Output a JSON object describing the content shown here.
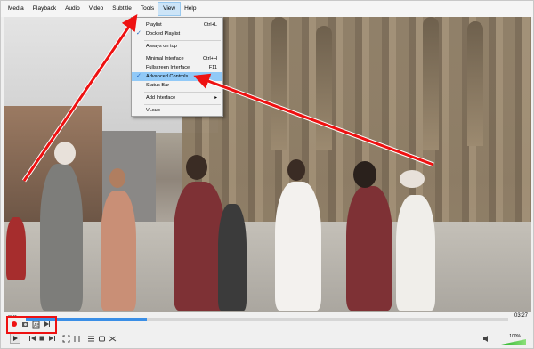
{
  "menubar": {
    "items": [
      "Media",
      "Playback",
      "Audio",
      "Video",
      "Subtitle",
      "Tools",
      "View",
      "Help"
    ]
  },
  "view_menu": {
    "items": [
      {
        "label": "Playlist",
        "shortcut": "Ctrl+L"
      },
      {
        "label": "Docked Playlist",
        "checked": true
      },
      {
        "label": "Always on top"
      },
      {
        "label": "Minimal Interface",
        "shortcut": "Ctrl+H"
      },
      {
        "label": "Fullscreen Interface",
        "shortcut": "F11"
      },
      {
        "label": "Advanced Controls",
        "checked": true,
        "highlighted": true
      },
      {
        "label": "Status Bar"
      },
      {
        "label": "Add Interface",
        "submenu": true
      },
      {
        "label": "VLsub"
      }
    ]
  },
  "playback": {
    "elapsed": "--:--",
    "total": "03:27",
    "progress": 0.25
  },
  "volume": {
    "label": "100%",
    "level": 1.0
  },
  "colors": {
    "highlight": "#91c9f7",
    "annotation": "#e11111",
    "seek_fill": "#3a8ee6"
  },
  "icons": {
    "advanced": [
      "record-icon",
      "snapshot-icon",
      "loop-ab-icon",
      "frame-step-icon"
    ],
    "main": [
      "play-icon",
      "prev-icon",
      "stop-icon",
      "next-icon",
      "fullscreen-icon",
      "extended-settings-icon",
      "playlist-icon",
      "loop-icon",
      "shuffle-icon",
      "speaker-icon"
    ]
  }
}
